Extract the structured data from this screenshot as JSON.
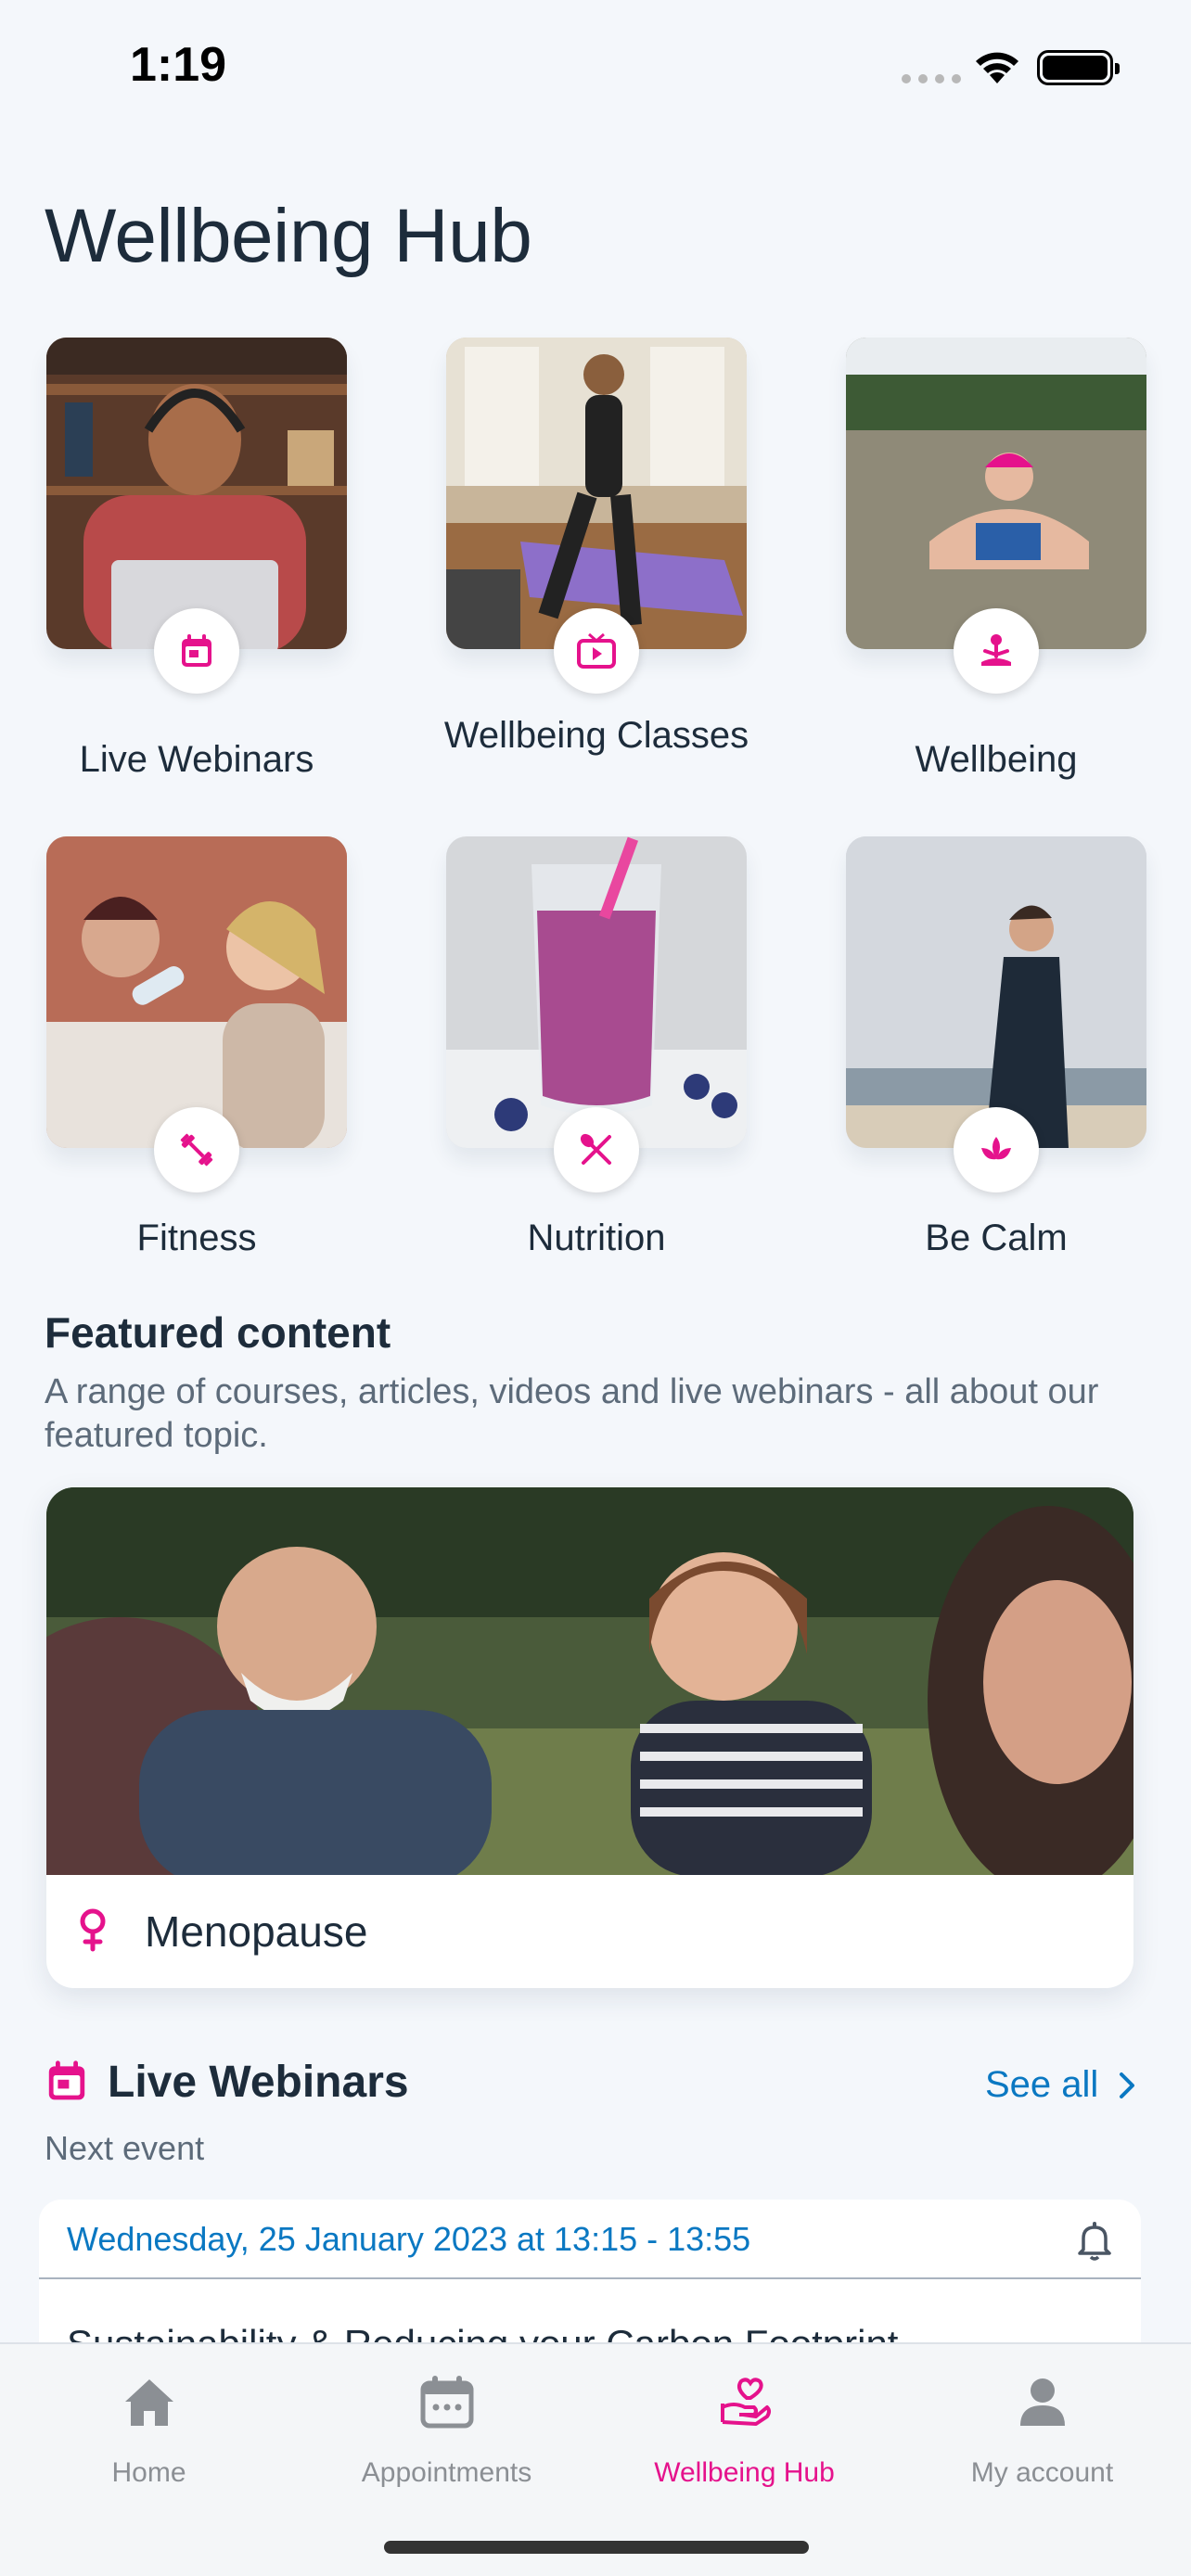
{
  "status_bar": {
    "time": "1:19"
  },
  "page": {
    "title": "Wellbeing Hub"
  },
  "categories": [
    {
      "label": "Live Webinars",
      "icon": "calendar-icon"
    },
    {
      "label": "Wellbeing Classes",
      "icon": "tv-icon"
    },
    {
      "label": "Wellbeing",
      "icon": "meditation-icon"
    },
    {
      "label": "Fitness",
      "icon": "dumbbell-icon"
    },
    {
      "label": "Nutrition",
      "icon": "utensils-icon"
    },
    {
      "label": "Be Calm",
      "icon": "lotus-icon"
    }
  ],
  "featured": {
    "title": "Featured content",
    "subtitle": "A range of courses, articles, videos and live webinars - all about our featured topic.",
    "card_label": "Menopause",
    "card_icon": "female-symbol-icon"
  },
  "webinars": {
    "title": "Live Webinars",
    "see_all": "See all",
    "next_event_label": "Next event",
    "event_date": "Wednesday, 25 January 2023 at 13:15 - 13:55",
    "event_title": "Sustainability & Reducing your Carbon Footprint"
  },
  "tab_bar": {
    "items": [
      {
        "label": "Home",
        "icon": "home-icon",
        "active": false
      },
      {
        "label": "Appointments",
        "icon": "calendar-icon",
        "active": false
      },
      {
        "label": "Wellbeing Hub",
        "icon": "heart-hand-icon",
        "active": true
      },
      {
        "label": "My account",
        "icon": "person-icon",
        "active": false
      }
    ]
  },
  "colors": {
    "accent": "#e5128c",
    "link": "#0a78c2",
    "background": "#f4f7fb",
    "text": "#1d2c3b",
    "muted": "#5d6b7a"
  }
}
